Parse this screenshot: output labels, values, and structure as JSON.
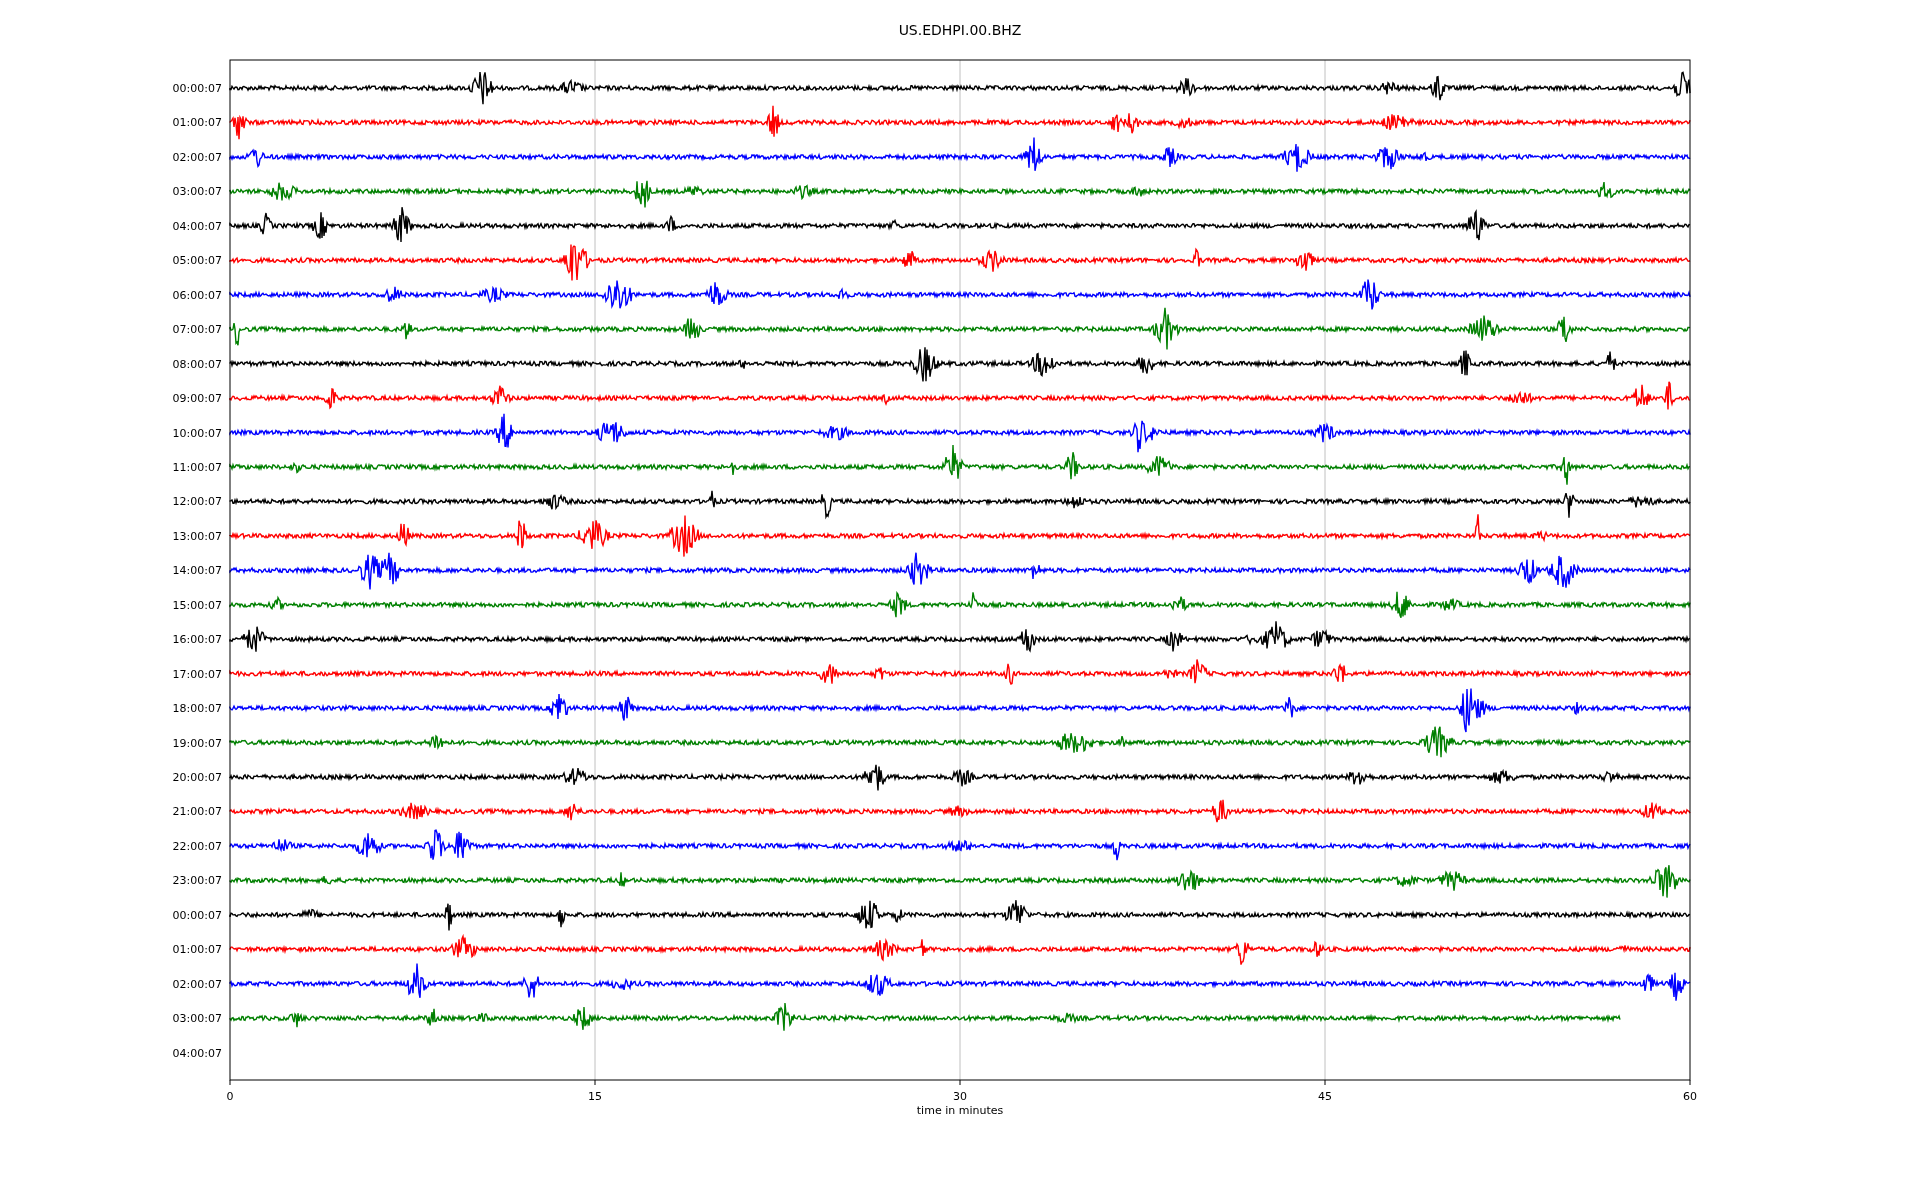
{
  "title": "US.EDHPI.00.BHZ",
  "rows": [
    {
      "label": "00:00:07",
      "color": "#000000",
      "kind": "full"
    },
    {
      "label": "01:00:07",
      "color": "#ff0000",
      "kind": "full"
    },
    {
      "label": "02:00:07",
      "color": "#0000ff",
      "kind": "full"
    },
    {
      "label": "03:00:07",
      "color": "#008000",
      "kind": "full"
    },
    {
      "label": "04:00:07",
      "color": "#000000",
      "kind": "full"
    },
    {
      "label": "05:00:07",
      "color": "#ff0000",
      "kind": "full"
    },
    {
      "label": "06:00:07",
      "color": "#0000ff",
      "kind": "full"
    },
    {
      "label": "07:00:07",
      "color": "#008000",
      "kind": "full"
    },
    {
      "label": "08:00:07",
      "color": "#000000",
      "kind": "full"
    },
    {
      "label": "09:00:07",
      "color": "#ff0000",
      "kind": "full"
    },
    {
      "label": "10:00:07",
      "color": "#0000ff",
      "kind": "full"
    },
    {
      "label": "11:00:07",
      "color": "#008000",
      "kind": "full"
    },
    {
      "label": "12:00:07",
      "color": "#000000",
      "kind": "full"
    },
    {
      "label": "13:00:07",
      "color": "#ff0000",
      "kind": "full"
    },
    {
      "label": "14:00:07",
      "color": "#0000ff",
      "kind": "full"
    },
    {
      "label": "15:00:07",
      "color": "#008000",
      "kind": "full"
    },
    {
      "label": "16:00:07",
      "color": "#000000",
      "kind": "full"
    },
    {
      "label": "17:00:07",
      "color": "#ff0000",
      "kind": "full"
    },
    {
      "label": "18:00:07",
      "color": "#0000ff",
      "kind": "full"
    },
    {
      "label": "19:00:07",
      "color": "#008000",
      "kind": "full"
    },
    {
      "label": "20:00:07",
      "color": "#000000",
      "kind": "full"
    },
    {
      "label": "21:00:07",
      "color": "#ff0000",
      "kind": "full"
    },
    {
      "label": "22:00:07",
      "color": "#0000ff",
      "kind": "full"
    },
    {
      "label": "23:00:07",
      "color": "#008000",
      "kind": "full"
    },
    {
      "label": "00:00:07",
      "color": "#000000",
      "kind": "full"
    },
    {
      "label": "01:00:07",
      "color": "#ff0000",
      "kind": "full"
    },
    {
      "label": "02:00:07",
      "color": "#0000ff",
      "kind": "full"
    },
    {
      "label": "03:00:07",
      "color": "#008000",
      "kind": "partial"
    },
    {
      "label": "04:00:07",
      "kind": "empty"
    }
  ],
  "x_axis": {
    "ticks": [
      "0",
      "15",
      "30",
      "45",
      "60"
    ],
    "label": "time in minutes"
  }
}
